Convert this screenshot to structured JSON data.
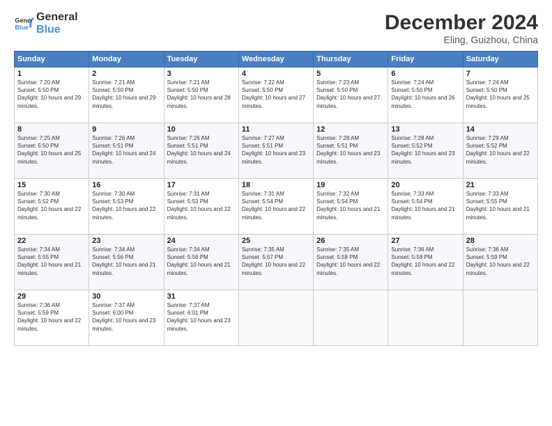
{
  "header": {
    "logo_line1": "General",
    "logo_line2": "Blue",
    "month": "December 2024",
    "location": "Eling, Guizhou, China"
  },
  "weekdays": [
    "Sunday",
    "Monday",
    "Tuesday",
    "Wednesday",
    "Thursday",
    "Friday",
    "Saturday"
  ],
  "weeks": [
    [
      {
        "day": "1",
        "sunrise": "7:20 AM",
        "sunset": "5:50 PM",
        "daylight": "10 hours and 29 minutes."
      },
      {
        "day": "2",
        "sunrise": "7:21 AM",
        "sunset": "5:50 PM",
        "daylight": "10 hours and 29 minutes."
      },
      {
        "day": "3",
        "sunrise": "7:21 AM",
        "sunset": "5:50 PM",
        "daylight": "10 hours and 28 minutes."
      },
      {
        "day": "4",
        "sunrise": "7:22 AM",
        "sunset": "5:50 PM",
        "daylight": "10 hours and 27 minutes."
      },
      {
        "day": "5",
        "sunrise": "7:23 AM",
        "sunset": "5:50 PM",
        "daylight": "10 hours and 27 minutes."
      },
      {
        "day": "6",
        "sunrise": "7:24 AM",
        "sunset": "5:50 PM",
        "daylight": "10 hours and 26 minutes."
      },
      {
        "day": "7",
        "sunrise": "7:24 AM",
        "sunset": "5:50 PM",
        "daylight": "10 hours and 25 minutes."
      }
    ],
    [
      {
        "day": "8",
        "sunrise": "7:25 AM",
        "sunset": "5:50 PM",
        "daylight": "10 hours and 25 minutes."
      },
      {
        "day": "9",
        "sunrise": "7:26 AM",
        "sunset": "5:51 PM",
        "daylight": "10 hours and 24 minutes."
      },
      {
        "day": "10",
        "sunrise": "7:26 AM",
        "sunset": "5:51 PM",
        "daylight": "10 hours and 24 minutes."
      },
      {
        "day": "11",
        "sunrise": "7:27 AM",
        "sunset": "5:51 PM",
        "daylight": "10 hours and 23 minutes."
      },
      {
        "day": "12",
        "sunrise": "7:28 AM",
        "sunset": "5:51 PM",
        "daylight": "10 hours and 23 minutes."
      },
      {
        "day": "13",
        "sunrise": "7:28 AM",
        "sunset": "5:52 PM",
        "daylight": "10 hours and 23 minutes."
      },
      {
        "day": "14",
        "sunrise": "7:29 AM",
        "sunset": "5:52 PM",
        "daylight": "10 hours and 22 minutes."
      }
    ],
    [
      {
        "day": "15",
        "sunrise": "7:30 AM",
        "sunset": "5:52 PM",
        "daylight": "10 hours and 22 minutes."
      },
      {
        "day": "16",
        "sunrise": "7:30 AM",
        "sunset": "5:53 PM",
        "daylight": "10 hours and 22 minutes."
      },
      {
        "day": "17",
        "sunrise": "7:31 AM",
        "sunset": "5:53 PM",
        "daylight": "10 hours and 22 minutes."
      },
      {
        "day": "18",
        "sunrise": "7:31 AM",
        "sunset": "5:54 PM",
        "daylight": "10 hours and 22 minutes."
      },
      {
        "day": "19",
        "sunrise": "7:32 AM",
        "sunset": "5:54 PM",
        "daylight": "10 hours and 21 minutes."
      },
      {
        "day": "20",
        "sunrise": "7:33 AM",
        "sunset": "5:54 PM",
        "daylight": "10 hours and 21 minutes."
      },
      {
        "day": "21",
        "sunrise": "7:33 AM",
        "sunset": "5:55 PM",
        "daylight": "10 hours and 21 minutes."
      }
    ],
    [
      {
        "day": "22",
        "sunrise": "7:34 AM",
        "sunset": "5:55 PM",
        "daylight": "10 hours and 21 minutes."
      },
      {
        "day": "23",
        "sunrise": "7:34 AM",
        "sunset": "5:56 PM",
        "daylight": "10 hours and 21 minutes."
      },
      {
        "day": "24",
        "sunrise": "7:34 AM",
        "sunset": "5:56 PM",
        "daylight": "10 hours and 21 minutes."
      },
      {
        "day": "25",
        "sunrise": "7:35 AM",
        "sunset": "5:57 PM",
        "daylight": "10 hours and 22 minutes."
      },
      {
        "day": "26",
        "sunrise": "7:35 AM",
        "sunset": "5:58 PM",
        "daylight": "10 hours and 22 minutes."
      },
      {
        "day": "27",
        "sunrise": "7:36 AM",
        "sunset": "5:58 PM",
        "daylight": "10 hours and 22 minutes."
      },
      {
        "day": "28",
        "sunrise": "7:36 AM",
        "sunset": "5:59 PM",
        "daylight": "10 hours and 22 minutes."
      }
    ],
    [
      {
        "day": "29",
        "sunrise": "7:36 AM",
        "sunset": "5:59 PM",
        "daylight": "10 hours and 22 minutes."
      },
      {
        "day": "30",
        "sunrise": "7:37 AM",
        "sunset": "6:00 PM",
        "daylight": "10 hours and 23 minutes."
      },
      {
        "day": "31",
        "sunrise": "7:37 AM",
        "sunset": "6:01 PM",
        "daylight": "10 hours and 23 minutes."
      },
      null,
      null,
      null,
      null
    ]
  ],
  "labels": {
    "sunrise": "Sunrise:",
    "sunset": "Sunset:",
    "daylight": "Daylight:"
  }
}
